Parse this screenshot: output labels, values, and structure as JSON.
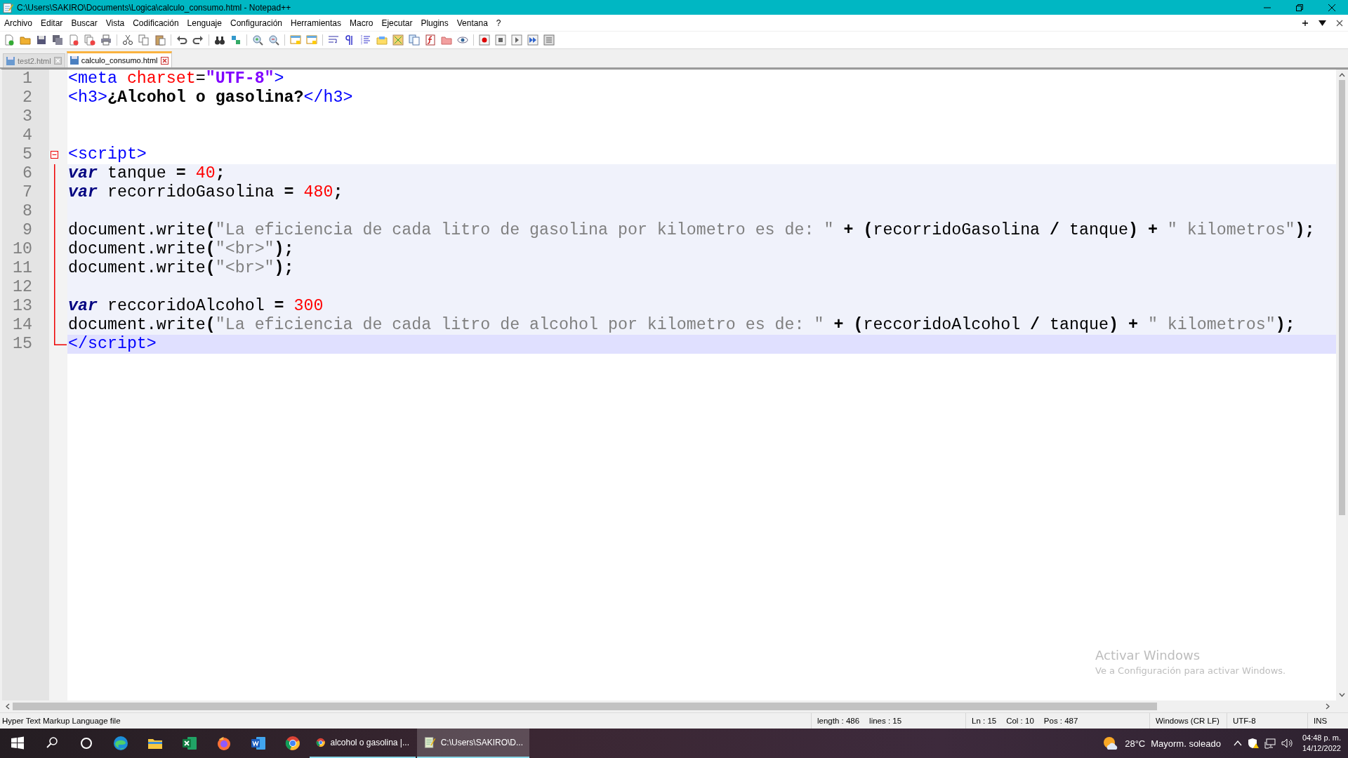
{
  "window": {
    "title": "C:\\Users\\SAKIRO\\Documents\\Logica\\calculo_consumo.html - Notepad++"
  },
  "menu": [
    "Archivo",
    "Editar",
    "Buscar",
    "Vista",
    "Codificación",
    "Lenguaje",
    "Configuración",
    "Herramientas",
    "Macro",
    "Ejecutar",
    "Plugins",
    "Ventana",
    "?"
  ],
  "tabs": [
    {
      "label": "test2.html",
      "selected": false
    },
    {
      "label": "calculo_consumo.html",
      "selected": true
    }
  ],
  "editor": {
    "lines": [
      {
        "number": "1",
        "current": false,
        "tokens": [
          {
            "kind": "tag",
            "text": "<meta"
          },
          {
            "kind": "attr",
            "text": " charset"
          },
          {
            "kind": "plain",
            "text": "="
          },
          {
            "kind": "attrval",
            "text": "\"UTF-8\""
          },
          {
            "kind": "tag",
            "text": ">"
          }
        ]
      },
      {
        "number": "2",
        "current": false,
        "tokens": [
          {
            "kind": "tag",
            "text": "<h3>"
          },
          {
            "kind": "bold",
            "text": "¿Alcohol o gasolina?"
          },
          {
            "kind": "tag",
            "text": "</h3>"
          }
        ]
      },
      {
        "number": "3",
        "current": false
      },
      {
        "number": "4",
        "current": false
      },
      {
        "number": "5",
        "kind": "start",
        "current": false,
        "tokens": [
          {
            "kind": "tag",
            "text": "<script>"
          }
        ]
      },
      {
        "number": "6",
        "kind": "body",
        "current": false,
        "tokens": [
          {
            "kind": "keyword",
            "text": "var"
          },
          {
            "kind": "plain",
            "text": " tanque "
          },
          {
            "kind": "op",
            "text": "="
          },
          {
            "kind": "number",
            "text": " 40"
          },
          {
            "kind": "op",
            "text": ";"
          }
        ]
      },
      {
        "number": "7",
        "kind": "body",
        "current": false,
        "tokens": [
          {
            "kind": "keyword",
            "text": "var"
          },
          {
            "kind": "plain",
            "text": " recorridoGasolina "
          },
          {
            "kind": "op",
            "text": "="
          },
          {
            "kind": "number",
            "text": " 480"
          },
          {
            "kind": "op",
            "text": ";"
          }
        ]
      },
      {
        "number": "8",
        "kind": "body",
        "current": false
      },
      {
        "number": "9",
        "kind": "body",
        "current": false,
        "tokens": [
          {
            "kind": "plain",
            "text": "document.write"
          },
          {
            "kind": "op",
            "text": "("
          },
          {
            "kind": "string",
            "text": "\"La eficiencia de cada litro de gasolina por kilometro es de: \""
          },
          {
            "kind": "op",
            "text": " + ("
          },
          {
            "kind": "plain",
            "text": "recorridoGasolina "
          },
          {
            "kind": "op",
            "text": "/"
          },
          {
            "kind": "plain",
            "text": " tanque"
          },
          {
            "kind": "op",
            "text": ") + "
          },
          {
            "kind": "string",
            "text": "\" kilometros\""
          },
          {
            "kind": "op",
            "text": ");"
          }
        ]
      },
      {
        "number": "10",
        "kind": "body",
        "current": false,
        "tokens": [
          {
            "kind": "plain",
            "text": "document.write"
          },
          {
            "kind": "op",
            "text": "("
          },
          {
            "kind": "string",
            "text": "\"<br>\""
          },
          {
            "kind": "op",
            "text": ");"
          }
        ]
      },
      {
        "number": "11",
        "kind": "body",
        "current": false,
        "tokens": [
          {
            "kind": "plain",
            "text": "document.write"
          },
          {
            "kind": "op",
            "text": "("
          },
          {
            "kind": "string",
            "text": "\"<br>\""
          },
          {
            "kind": "op",
            "text": ");"
          }
        ]
      },
      {
        "number": "12",
        "kind": "body",
        "current": false
      },
      {
        "number": "13",
        "kind": "body",
        "current": false,
        "tokens": [
          {
            "kind": "keyword",
            "text": "var"
          },
          {
            "kind": "plain",
            "text": " reccoridoAlcohol "
          },
          {
            "kind": "op",
            "text": "="
          },
          {
            "kind": "number",
            "text": " 300"
          }
        ]
      },
      {
        "number": "14",
        "kind": "body",
        "current": false,
        "tokens": [
          {
            "kind": "plain",
            "text": "document.write"
          },
          {
            "kind": "op",
            "text": "("
          },
          {
            "kind": "string",
            "text": "\"La eficiencia de cada litro de alcohol por kilometro es de: \""
          },
          {
            "kind": "op",
            "text": " + ("
          },
          {
            "kind": "plain",
            "text": "reccoridoAlcohol "
          },
          {
            "kind": "op",
            "text": "/"
          },
          {
            "kind": "plain",
            "text": " tanque"
          },
          {
            "kind": "op",
            "text": ") + "
          },
          {
            "kind": "string",
            "text": "\" kilometros\""
          },
          {
            "kind": "op",
            "text": ");"
          }
        ]
      },
      {
        "number": "15",
        "kind": "end",
        "current": true,
        "tokens": [
          {
            "kind": "tag",
            "text": "</script>"
          }
        ]
      }
    ]
  },
  "activation_notice": {
    "title": "Activar Windows",
    "text": "Ve a Configuración para activar Windows."
  },
  "status_bar": {
    "file_type": "Hyper Text Markup Language file",
    "sections": [
      {
        "items": [
          "length : 486",
          "lines : 15"
        ]
      },
      {
        "items": [
          "Ln : 15",
          "Col : 10",
          "Pos : 487"
        ]
      },
      {
        "items": [
          "Windows (CR LF)"
        ]
      },
      {
        "items": [
          "UTF-8"
        ]
      },
      {
        "items": [
          "INS"
        ]
      }
    ]
  },
  "taskbar": {
    "windows": [
      {
        "kind": "browser",
        "label": "alcohol o gasolina |...",
        "selected": false
      },
      {
        "kind": "editor",
        "label": "C:\\Users\\SAKIRO\\D...",
        "selected": true
      }
    ],
    "weather": {
      "temperature": "28°C",
      "condition": "Mayorm. soleado"
    },
    "clock": {
      "time": "04:48 p. m.",
      "date": "14/12/2022"
    }
  }
}
